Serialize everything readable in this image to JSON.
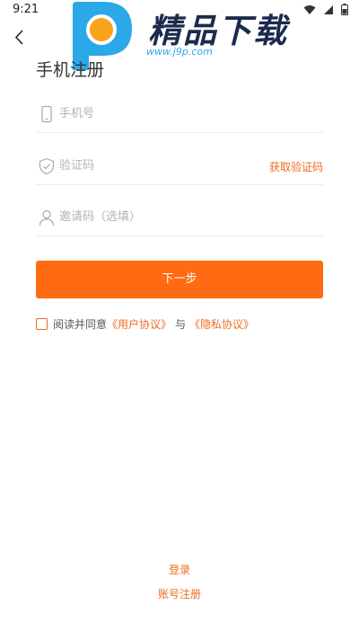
{
  "status_bar": {
    "time": "9:21",
    "icons": [
      "wifi-icon",
      "signal-icon",
      "battery-icon"
    ]
  },
  "header": {
    "back_icon": "back-arrow-icon"
  },
  "watermark": {
    "title": "精品下载",
    "url": "www.j9p.com",
    "colors": {
      "p_blue": "#2aa8e8",
      "p_orange": "#f7a31b",
      "title": "#1c2a4d"
    }
  },
  "page_title": "手机注册",
  "form": {
    "phone_placeholder": "手机号",
    "code_placeholder": "验证码",
    "get_code_label": "获取验证码",
    "invite_placeholder": "邀请码（选填）",
    "next_label": "下一步"
  },
  "agreement": {
    "prefix": "阅读并同意",
    "user_protocol": "《用户协议》",
    "and": "与",
    "privacy_protocol": "《隐私协议》",
    "checked": false
  },
  "footer": {
    "login_label": "登录",
    "account_register_label": "账号注册"
  },
  "colors": {
    "accent": "#ff6a13",
    "link": "#f06a1f",
    "placeholder": "#b3b3b3",
    "divider": "#ececec"
  }
}
